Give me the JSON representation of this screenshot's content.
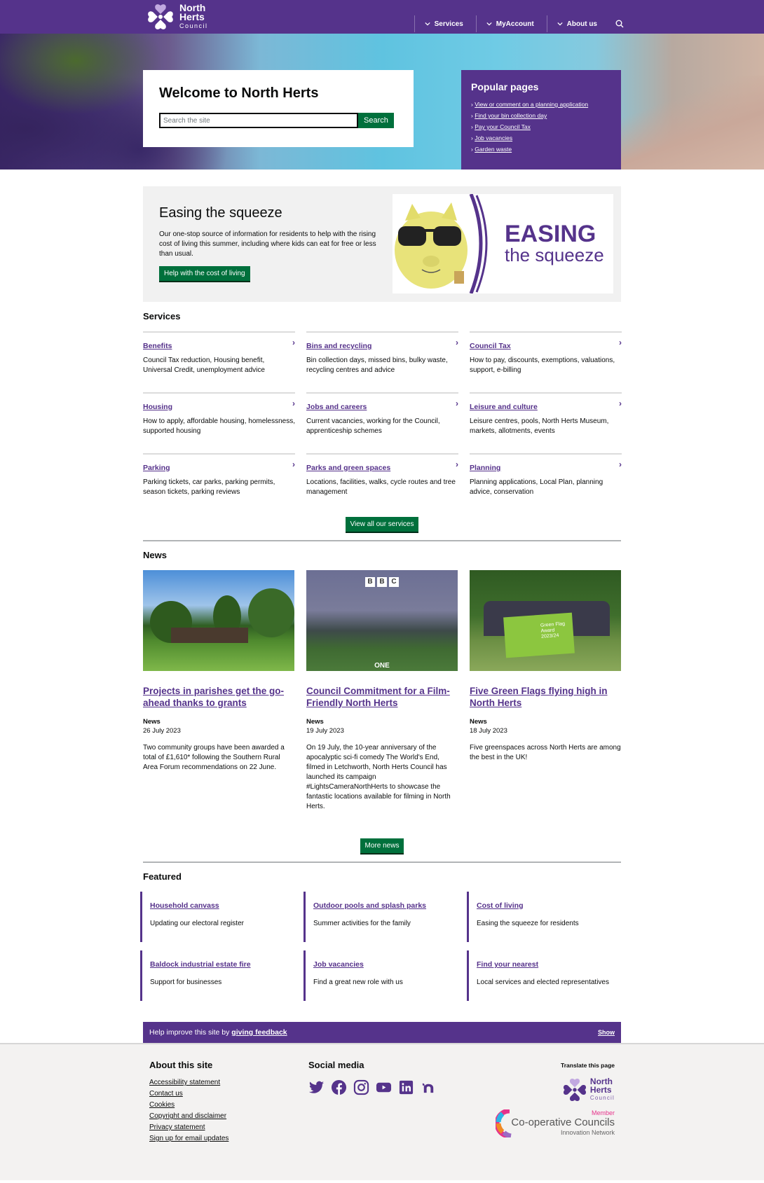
{
  "header": {
    "logo": {
      "line1": "North",
      "line2": "Herts",
      "line3": "Council"
    },
    "nav": [
      {
        "label": "Services"
      },
      {
        "label": "MyAccount"
      },
      {
        "label": "About us"
      }
    ],
    "search_icon": "search-icon"
  },
  "hero": {
    "title": "Welcome to North Herts",
    "search_placeholder": "Search the site",
    "search_button": "Search",
    "popular": {
      "title": "Popular pages",
      "links": [
        "View or comment on a planning application",
        "Find your bin collection day",
        "Pay your Council Tax",
        "Job vacancies",
        "Garden waste"
      ]
    }
  },
  "easing": {
    "title": "Easing the squeeze",
    "body": "Our one-stop source of information for residents to help with the rising cost of living this summer, including where kids can eat for free or less than usual.",
    "button": "Help with the cost of living",
    "image_text1": "EASING",
    "image_text2": "the squeeze"
  },
  "services": {
    "title": "Services",
    "items": [
      {
        "label": "Benefits",
        "desc": "Council Tax reduction, Housing benefit, Universal Credit, unemployment advice"
      },
      {
        "label": "Bins and recycling",
        "desc": "Bin collection days, missed bins, bulky waste, recycling centres and advice"
      },
      {
        "label": "Council Tax",
        "desc": "How to pay, discounts, exemptions, valuations, support, e-billing"
      },
      {
        "label": "Housing",
        "desc": "How to apply, affordable housing, homelessness, supported housing"
      },
      {
        "label": "Jobs and careers",
        "desc": "Current vacancies, working for the Council, apprenticeship schemes"
      },
      {
        "label": "Leisure and culture",
        "desc": "Leisure centres, pools, North Herts Museum, markets, allotments, events"
      },
      {
        "label": "Parking",
        "desc": "Parking tickets, car parks, parking permits, season tickets, parking reviews"
      },
      {
        "label": "Parks and green spaces",
        "desc": "Locations, facilities, walks, cycle routes and tree management"
      },
      {
        "label": "Planning",
        "desc": "Planning applications, Local Plan, planning advice, conservation"
      }
    ],
    "view_all": "View all our services",
    "arrow": "›"
  },
  "news": {
    "title": "News",
    "items": [
      {
        "title": "Projects in parishes get the go-ahead thanks to grants",
        "type": "News",
        "date": "26 July 2023",
        "desc": "Two community groups have been awarded a total of £1,610* following the Southern Rural Area Forum recommendations on 22 June."
      },
      {
        "title": "Council Commitment for a Film-Friendly North Herts",
        "type": "News",
        "date": "19 July 2023",
        "desc": "On 19 July, the 10-year anniversary of the apocalyptic sci-fi comedy The World's End, filmed in Letchworth, North Herts Council has launched its campaign #LightsCameraNorthHerts to showcase the fantastic locations available for filming in North Herts.",
        "img_text1": "BBC",
        "img_text2": "ONE"
      },
      {
        "title": "Five Green Flags flying high in North Herts",
        "type": "News",
        "date": "18 July 2023",
        "desc": "Five greenspaces across North Herts are among the best in the UK!",
        "img_text": "Green Flag Award 2023/24"
      }
    ],
    "more": "More news"
  },
  "featured": {
    "title": "Featured",
    "items": [
      {
        "label": "Household canvass",
        "desc": "Updating our electoral register"
      },
      {
        "label": "Outdoor pools and splash parks",
        "desc": "Summer activities for the family"
      },
      {
        "label": "Cost of living",
        "desc": "Easing the squeeze for residents"
      },
      {
        "label": "Baldock industrial estate fire",
        "desc": "Support for businesses"
      },
      {
        "label": "Job vacancies",
        "desc": "Find a great new role with us"
      },
      {
        "label": "Find your nearest",
        "desc": "Local services and elected representatives"
      }
    ]
  },
  "feedback": {
    "text": "Help improve this site by ",
    "link": "giving feedback",
    "show": "Show"
  },
  "footer": {
    "about_title": "About this site",
    "about_links": [
      "Accessibility statement",
      "Contact us",
      "Cookies",
      "Copyright and disclaimer",
      "Privacy statement",
      "Sign up for email updates"
    ],
    "social_title": "Social media",
    "social": [
      "twitter-icon",
      "facebook-icon",
      "instagram-icon",
      "youtube-icon",
      "linkedin-icon",
      "nextdoor-icon"
    ],
    "translate": "Translate this page",
    "coop": {
      "member": "Member",
      "name": "Co-operative Councils",
      "sub": "Innovation Network"
    }
  },
  "colors": {
    "brand_purple": "#55338b",
    "accent_green": "#8cc63f",
    "button_green": "#00703c"
  }
}
